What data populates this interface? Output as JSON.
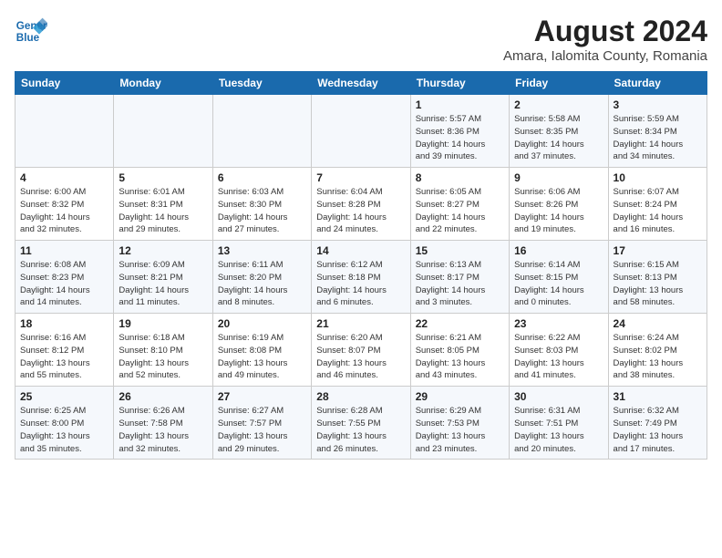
{
  "header": {
    "logo_line1": "General",
    "logo_line2": "Blue",
    "month_year": "August 2024",
    "location": "Amara, Ialomita County, Romania"
  },
  "weekdays": [
    "Sunday",
    "Monday",
    "Tuesday",
    "Wednesday",
    "Thursday",
    "Friday",
    "Saturday"
  ],
  "weeks": [
    [
      {
        "day": "",
        "info": ""
      },
      {
        "day": "",
        "info": ""
      },
      {
        "day": "",
        "info": ""
      },
      {
        "day": "",
        "info": ""
      },
      {
        "day": "1",
        "info": "Sunrise: 5:57 AM\nSunset: 8:36 PM\nDaylight: 14 hours\nand 39 minutes."
      },
      {
        "day": "2",
        "info": "Sunrise: 5:58 AM\nSunset: 8:35 PM\nDaylight: 14 hours\nand 37 minutes."
      },
      {
        "day": "3",
        "info": "Sunrise: 5:59 AM\nSunset: 8:34 PM\nDaylight: 14 hours\nand 34 minutes."
      }
    ],
    [
      {
        "day": "4",
        "info": "Sunrise: 6:00 AM\nSunset: 8:32 PM\nDaylight: 14 hours\nand 32 minutes."
      },
      {
        "day": "5",
        "info": "Sunrise: 6:01 AM\nSunset: 8:31 PM\nDaylight: 14 hours\nand 29 minutes."
      },
      {
        "day": "6",
        "info": "Sunrise: 6:03 AM\nSunset: 8:30 PM\nDaylight: 14 hours\nand 27 minutes."
      },
      {
        "day": "7",
        "info": "Sunrise: 6:04 AM\nSunset: 8:28 PM\nDaylight: 14 hours\nand 24 minutes."
      },
      {
        "day": "8",
        "info": "Sunrise: 6:05 AM\nSunset: 8:27 PM\nDaylight: 14 hours\nand 22 minutes."
      },
      {
        "day": "9",
        "info": "Sunrise: 6:06 AM\nSunset: 8:26 PM\nDaylight: 14 hours\nand 19 minutes."
      },
      {
        "day": "10",
        "info": "Sunrise: 6:07 AM\nSunset: 8:24 PM\nDaylight: 14 hours\nand 16 minutes."
      }
    ],
    [
      {
        "day": "11",
        "info": "Sunrise: 6:08 AM\nSunset: 8:23 PM\nDaylight: 14 hours\nand 14 minutes."
      },
      {
        "day": "12",
        "info": "Sunrise: 6:09 AM\nSunset: 8:21 PM\nDaylight: 14 hours\nand 11 minutes."
      },
      {
        "day": "13",
        "info": "Sunrise: 6:11 AM\nSunset: 8:20 PM\nDaylight: 14 hours\nand 8 minutes."
      },
      {
        "day": "14",
        "info": "Sunrise: 6:12 AM\nSunset: 8:18 PM\nDaylight: 14 hours\nand 6 minutes."
      },
      {
        "day": "15",
        "info": "Sunrise: 6:13 AM\nSunset: 8:17 PM\nDaylight: 14 hours\nand 3 minutes."
      },
      {
        "day": "16",
        "info": "Sunrise: 6:14 AM\nSunset: 8:15 PM\nDaylight: 14 hours\nand 0 minutes."
      },
      {
        "day": "17",
        "info": "Sunrise: 6:15 AM\nSunset: 8:13 PM\nDaylight: 13 hours\nand 58 minutes."
      }
    ],
    [
      {
        "day": "18",
        "info": "Sunrise: 6:16 AM\nSunset: 8:12 PM\nDaylight: 13 hours\nand 55 minutes."
      },
      {
        "day": "19",
        "info": "Sunrise: 6:18 AM\nSunset: 8:10 PM\nDaylight: 13 hours\nand 52 minutes."
      },
      {
        "day": "20",
        "info": "Sunrise: 6:19 AM\nSunset: 8:08 PM\nDaylight: 13 hours\nand 49 minutes."
      },
      {
        "day": "21",
        "info": "Sunrise: 6:20 AM\nSunset: 8:07 PM\nDaylight: 13 hours\nand 46 minutes."
      },
      {
        "day": "22",
        "info": "Sunrise: 6:21 AM\nSunset: 8:05 PM\nDaylight: 13 hours\nand 43 minutes."
      },
      {
        "day": "23",
        "info": "Sunrise: 6:22 AM\nSunset: 8:03 PM\nDaylight: 13 hours\nand 41 minutes."
      },
      {
        "day": "24",
        "info": "Sunrise: 6:24 AM\nSunset: 8:02 PM\nDaylight: 13 hours\nand 38 minutes."
      }
    ],
    [
      {
        "day": "25",
        "info": "Sunrise: 6:25 AM\nSunset: 8:00 PM\nDaylight: 13 hours\nand 35 minutes."
      },
      {
        "day": "26",
        "info": "Sunrise: 6:26 AM\nSunset: 7:58 PM\nDaylight: 13 hours\nand 32 minutes."
      },
      {
        "day": "27",
        "info": "Sunrise: 6:27 AM\nSunset: 7:57 PM\nDaylight: 13 hours\nand 29 minutes."
      },
      {
        "day": "28",
        "info": "Sunrise: 6:28 AM\nSunset: 7:55 PM\nDaylight: 13 hours\nand 26 minutes."
      },
      {
        "day": "29",
        "info": "Sunrise: 6:29 AM\nSunset: 7:53 PM\nDaylight: 13 hours\nand 23 minutes."
      },
      {
        "day": "30",
        "info": "Sunrise: 6:31 AM\nSunset: 7:51 PM\nDaylight: 13 hours\nand 20 minutes."
      },
      {
        "day": "31",
        "info": "Sunrise: 6:32 AM\nSunset: 7:49 PM\nDaylight: 13 hours\nand 17 minutes."
      }
    ]
  ]
}
